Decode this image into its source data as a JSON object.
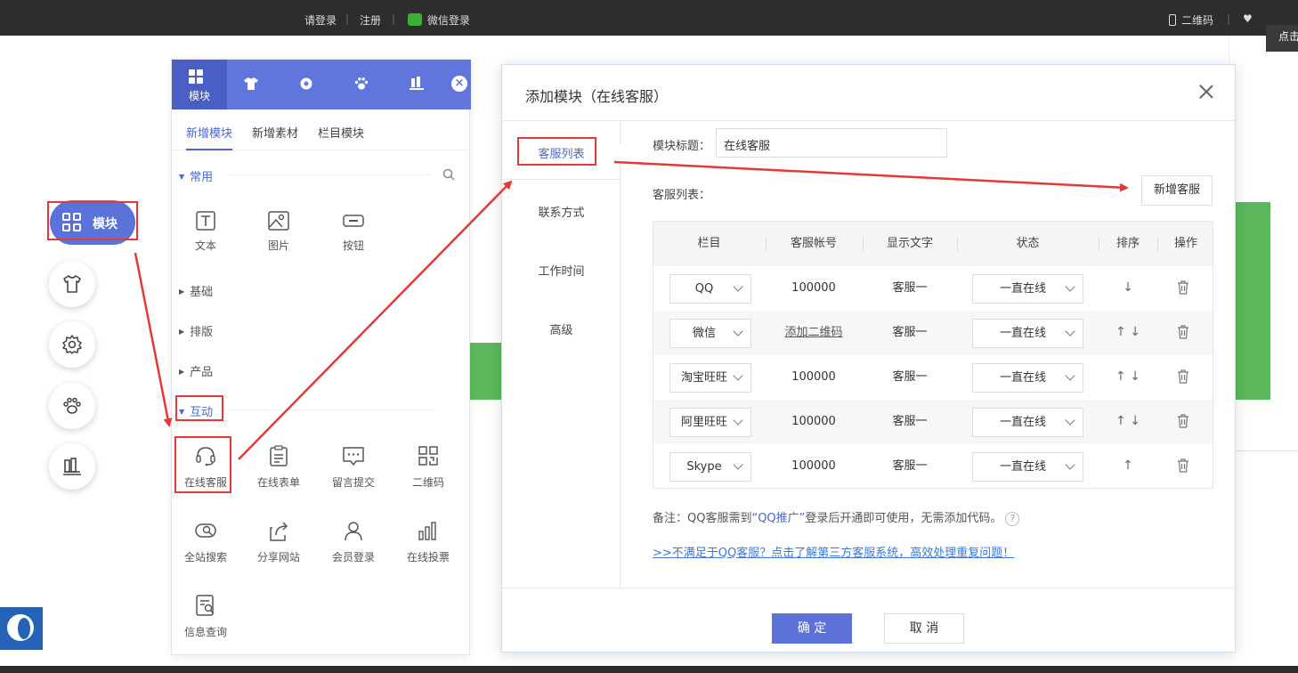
{
  "topbar": {
    "login": "请登录",
    "sep": "|",
    "register": "注册",
    "wechat_login": "微信登录",
    "qrcode": "二维码",
    "corner_tip": "点击"
  },
  "left_fab": {
    "active_label": "模块"
  },
  "panel": {
    "tabs": [
      {
        "label": "模块",
        "icon": "grid-icon"
      },
      {
        "label": "",
        "icon": "shirt-icon"
      },
      {
        "label": "",
        "icon": "gear-icon"
      },
      {
        "label": "",
        "icon": "paw-icon"
      },
      {
        "label": "",
        "icon": "books-icon"
      }
    ],
    "close": "×",
    "subtabs": [
      "新增模块",
      "新增素材",
      "栏目模块"
    ],
    "sections": {
      "common": "常用",
      "basic": "基础",
      "layout": "排版",
      "product": "产品",
      "interact": "互动"
    },
    "common_tools": [
      "文本",
      "图片",
      "按钮"
    ],
    "interact_tools": [
      "在线客服",
      "在线表单",
      "留言提交",
      "二维码",
      "全站搜索",
      "分享网站",
      "会员登录",
      "在线投票",
      "信息查询"
    ]
  },
  "dialog": {
    "title": "添加模块（在线客服）",
    "side": [
      "客服列表",
      "联系方式",
      "工作时间",
      "高级"
    ],
    "title_label": "模块标题：",
    "title_value": "在线客服",
    "list_label": "客服列表：",
    "add_button": "新增客服",
    "columns": [
      "栏目",
      "客服帐号",
      "显示文字",
      "状态",
      "排序",
      "操作"
    ],
    "rows": [
      {
        "type": "QQ",
        "account": "100000",
        "text": "客服一",
        "status": "一直在线",
        "sort": "↓"
      },
      {
        "type": "微信",
        "account": "添加二维码",
        "text": "客服一",
        "status": "一直在线",
        "sort": "↑ ↓"
      },
      {
        "type": "淘宝旺旺",
        "account": "100000",
        "text": "客服一",
        "status": "一直在线",
        "sort": "↑ ↓"
      },
      {
        "type": "阿里旺旺",
        "account": "100000",
        "text": "客服一",
        "status": "一直在线",
        "sort": "↑ ↓"
      },
      {
        "type": "Skype",
        "account": "100000",
        "text": "客服一",
        "status": "一直在线",
        "sort": "↑"
      }
    ],
    "note_prefix": "备注：QQ客服需到",
    "note_link": "“QQ推广”",
    "note_suffix": "登录后开通即可使用，无需添加代码。",
    "help": "?",
    "more_link": ">>不满足于QQ客服？点击了解第三方客服系统，高效处理重复问题！",
    "ok": "确 定",
    "cancel": "取 消"
  },
  "colors": {
    "accent": "#5b73d9",
    "annotation_red": "#e53935",
    "green": "#5cb85c"
  }
}
